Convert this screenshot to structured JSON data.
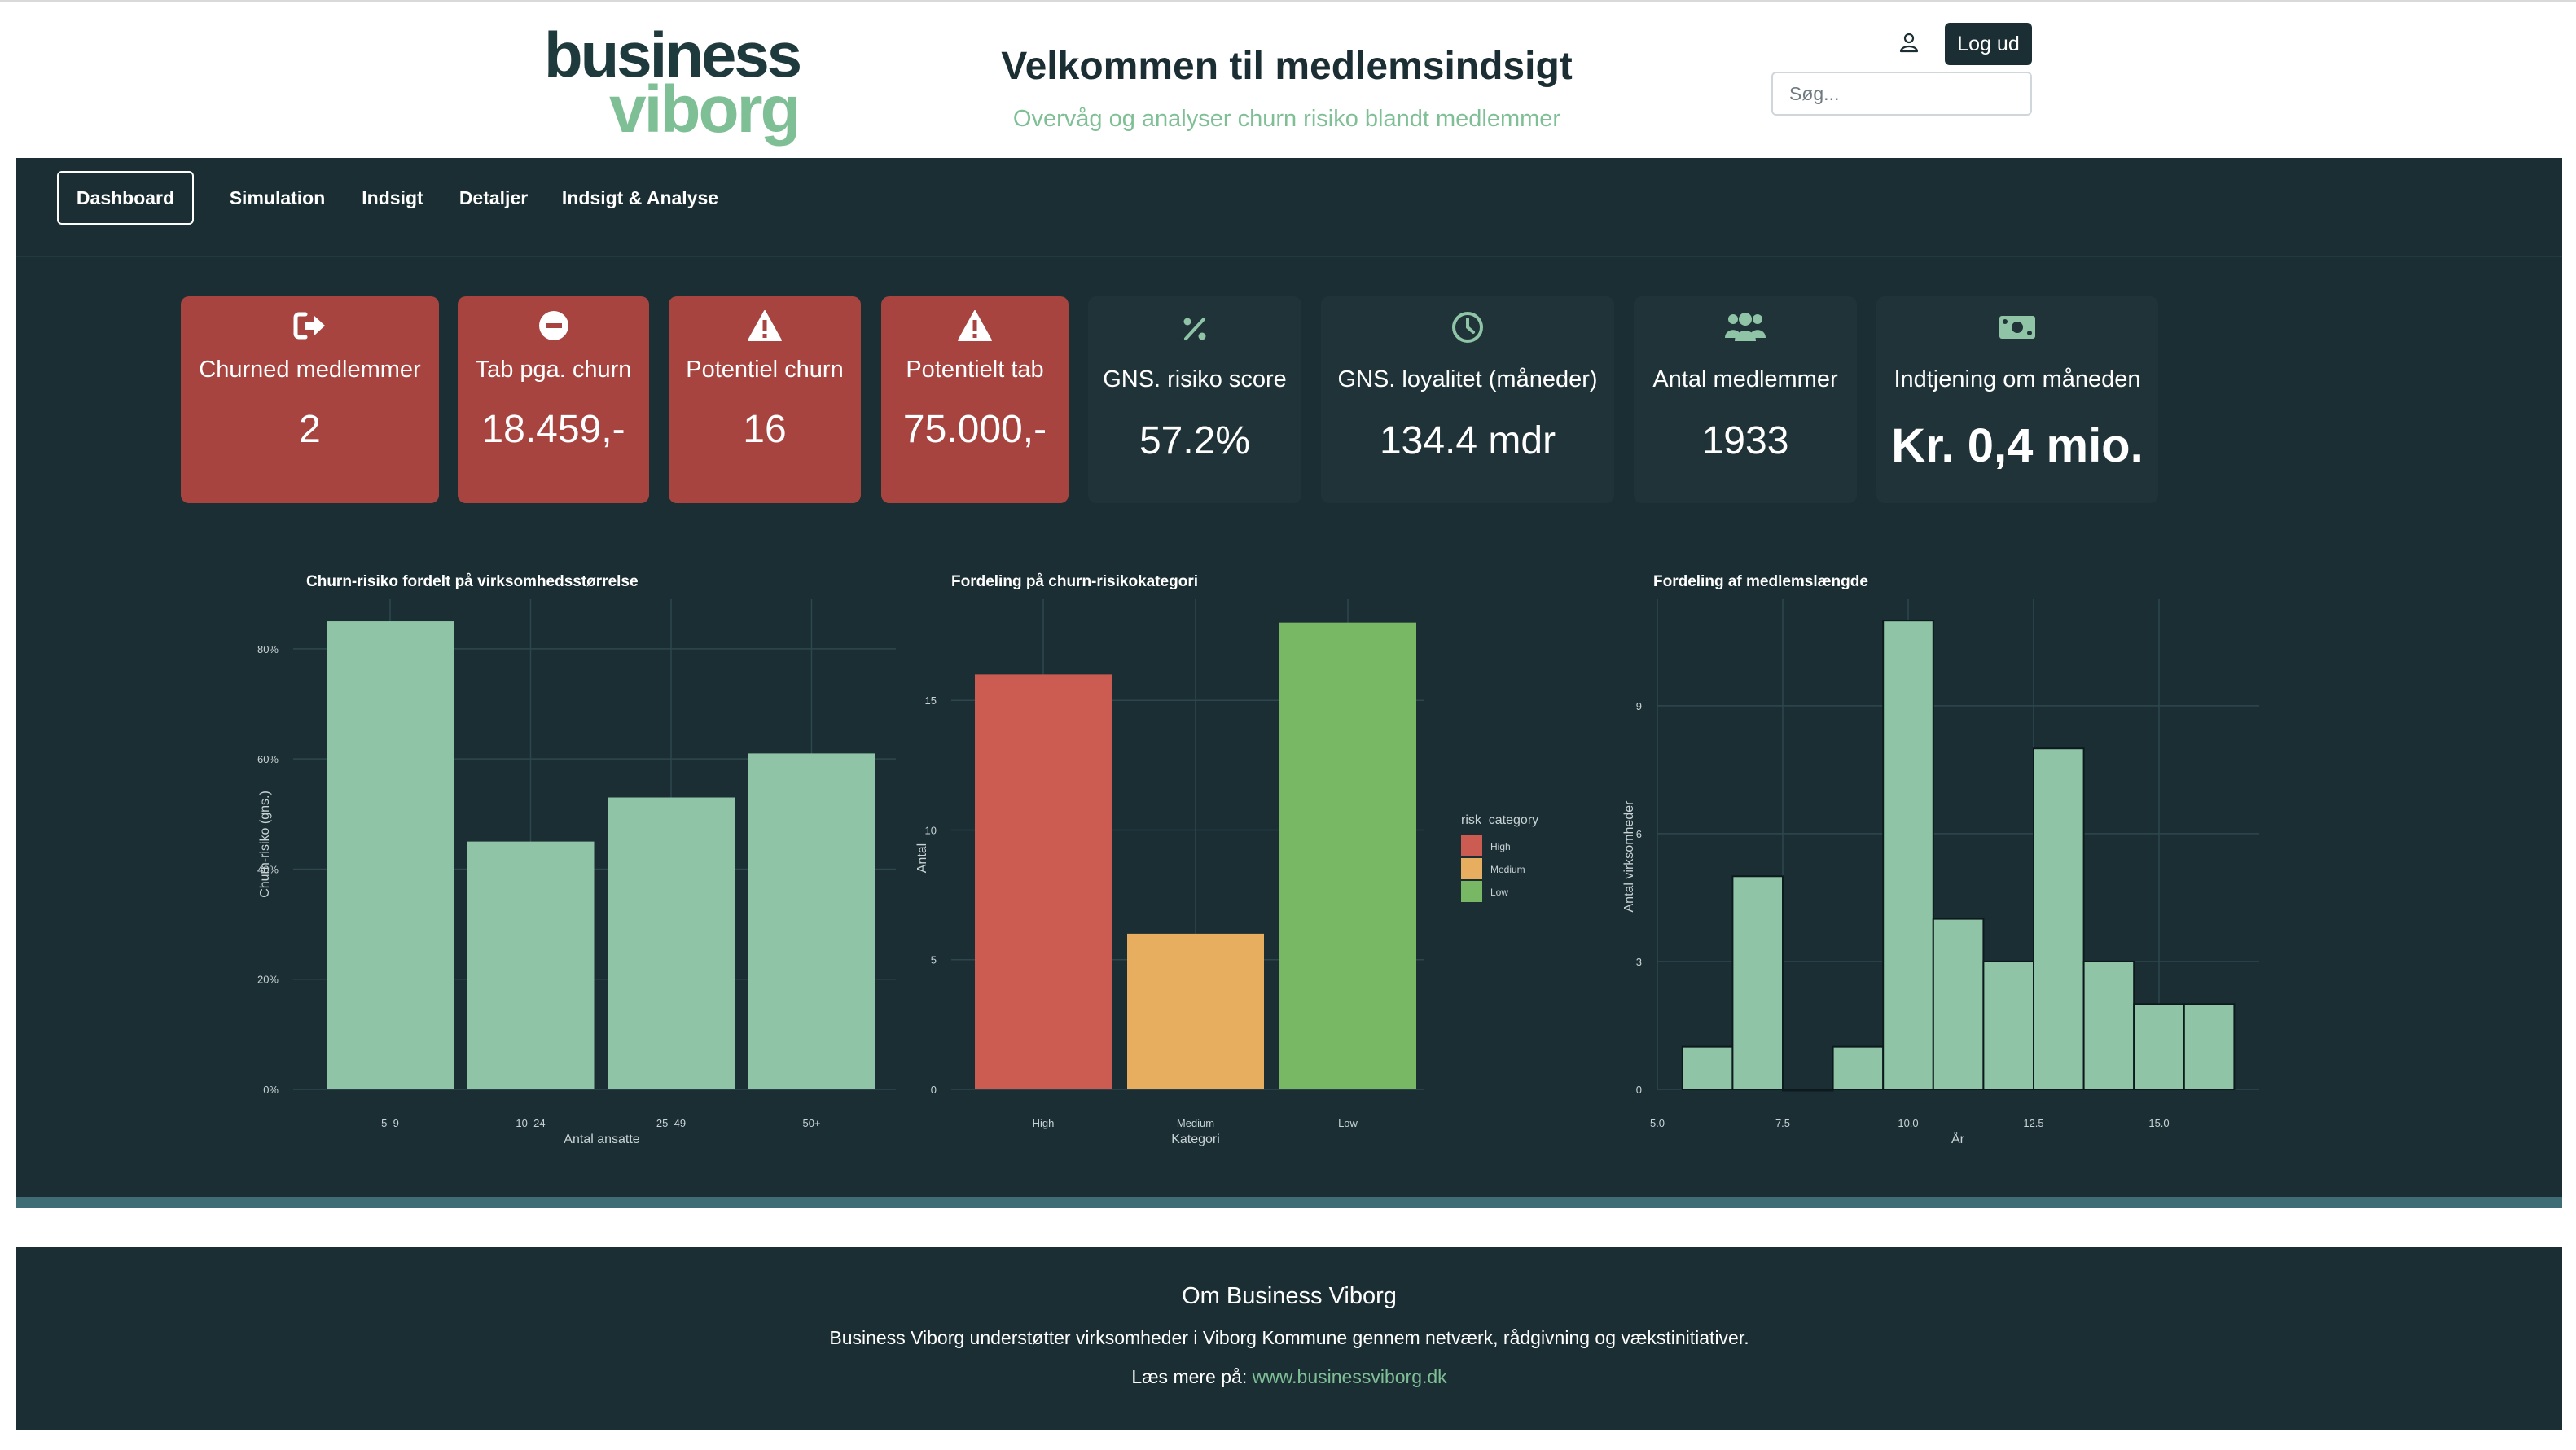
{
  "header": {
    "logo_line1": "business",
    "logo_line2": "viborg",
    "title": "Velkommen til medlemsindsigt",
    "subtitle": "Overvåg og analyser churn risiko blandt medlemmer",
    "logout_label": "Log ud",
    "search_placeholder": "Søg...",
    "user_icon": "user-icon"
  },
  "nav": {
    "tabs": [
      {
        "label": "Dashboard",
        "active": true
      },
      {
        "label": "Simulation",
        "active": false
      },
      {
        "label": "Indsigt",
        "active": false
      },
      {
        "label": "Detaljer",
        "active": false
      },
      {
        "label": "Indsigt & Analyse",
        "active": false
      }
    ]
  },
  "kpis": [
    {
      "icon": "sign-out-icon",
      "label": "Churned medlemmer",
      "value": "2",
      "color": "#a74440"
    },
    {
      "icon": "minus-circle-icon",
      "label": "Tab pga. churn",
      "value": "18.459,-",
      "color": "#a74440"
    },
    {
      "icon": "warning-icon",
      "label": "Potentiel churn",
      "value": "16",
      "color": "#a74440"
    },
    {
      "icon": "warning-icon",
      "label": "Potentielt tab",
      "value": "75.000,-",
      "color": "#a74440"
    },
    {
      "icon": "percent-icon",
      "label": "GNS. risiko score",
      "value": "57.2%",
      "color": "#1f3338"
    },
    {
      "icon": "clock-icon",
      "label": "GNS. loyalitet (måneder)",
      "value": "134.4 mdr",
      "color": "#1f3338"
    },
    {
      "icon": "users-icon",
      "label": "Antal medlemmer",
      "value": "1933",
      "color": "#1f3338"
    },
    {
      "icon": "money-icon",
      "label": "Indtjening om måneden",
      "value": "Kr. 0,4 mio.",
      "color": "#1f3338"
    }
  ],
  "chart_data": [
    {
      "type": "bar",
      "title": "Churn-risiko fordelt på virksomhedsstørrelse",
      "xlabel": "Antal ansatte",
      "ylabel": "Churn-risiko (gns.)",
      "categories": [
        "5–9",
        "10–24",
        "25–49",
        "50+"
      ],
      "values": [
        85,
        45,
        53,
        61
      ],
      "ylim": [
        0,
        89
      ],
      "yticks": [
        "0%",
        "20%",
        "40%",
        "60%",
        "80%"
      ],
      "color": "#8fc5a6",
      "grid": true
    },
    {
      "type": "bar",
      "title": "Fordeling på churn-risikokategori",
      "xlabel": "Kategori",
      "ylabel": "Antal",
      "categories": [
        "High",
        "Medium",
        "Low"
      ],
      "values": [
        16,
        6,
        18
      ],
      "ylim": [
        0,
        18.9
      ],
      "yticks": [
        "0",
        "5",
        "10",
        "15"
      ],
      "colors": [
        "#cc5b52",
        "#e6ae5e",
        "#78b865"
      ],
      "legend": {
        "title": "risk_category",
        "items": [
          "High",
          "Medium",
          "Low"
        ],
        "position": "right"
      },
      "grid": true
    },
    {
      "type": "bar",
      "title": "Fordeling af medlemslængde",
      "xlabel": "År",
      "ylabel": "Antal virksomheder",
      "bins": [
        [
          5.5,
          6.5
        ],
        [
          6.5,
          7.5
        ],
        [
          7.5,
          8.5
        ],
        [
          8.5,
          9.5
        ],
        [
          9.5,
          10.5
        ],
        [
          10.5,
          11.5
        ],
        [
          11.5,
          12.5
        ],
        [
          12.5,
          13.5
        ],
        [
          13.5,
          14.5
        ],
        [
          14.5,
          15.5
        ],
        [
          15.5,
          16.5
        ]
      ],
      "values": [
        1,
        5,
        0,
        1,
        11,
        4,
        3,
        8,
        3,
        2,
        2
      ],
      "xlim": [
        5,
        17
      ],
      "ylim": [
        0,
        11.5
      ],
      "xticks": [
        "5.0",
        "7.5",
        "10.0",
        "12.5",
        "15.0"
      ],
      "yticks": [
        "0",
        "3",
        "6",
        "9"
      ],
      "color": "#8fc5a6",
      "grid": true
    }
  ],
  "footer": {
    "title": "Om Business Viborg",
    "text": "Business Viborg understøtter virksomheder i Viborg Kommune gennem netværk, rådgivning og vækstinitiativer.",
    "more_prefix": "Læs mere på: ",
    "link": "www.businessviborg.dk"
  }
}
